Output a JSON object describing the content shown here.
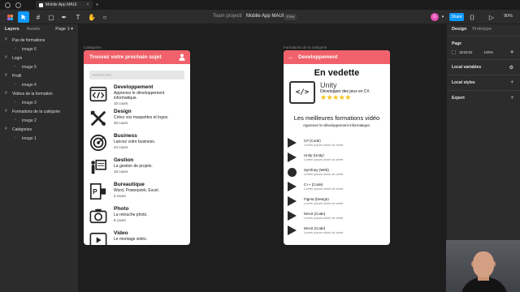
{
  "os": {
    "tab_title": "Mobile App MAUI"
  },
  "toolbar": {
    "breadcrumb_project": "Team project",
    "breadcrumb_sep": "/",
    "breadcrumb_file": "Mobile App MAUI",
    "plan_badge": "Free",
    "avatar_initial": "G",
    "share_label": "Share",
    "zoom": "90%"
  },
  "left_panel": {
    "tabs": [
      "Layers",
      "Assets"
    ],
    "page": "Page 1",
    "layers": [
      {
        "label": "Pas de formations",
        "level": "top"
      },
      {
        "label": "image 6",
        "level": "child"
      },
      {
        "label": "Login",
        "level": "top"
      },
      {
        "label": "image 5",
        "level": "child"
      },
      {
        "label": "Profil",
        "level": "top"
      },
      {
        "label": "image 4",
        "level": "child"
      },
      {
        "label": "Vidéos de la formation",
        "level": "top"
      },
      {
        "label": "image 3",
        "level": "child"
      },
      {
        "label": "Formations de la catégorie",
        "level": "top"
      },
      {
        "label": "image 2",
        "level": "child"
      },
      {
        "label": "Catégories",
        "level": "top"
      },
      {
        "label": "image 1",
        "level": "child"
      }
    ]
  },
  "canvas": {
    "frame1_label": "Catégories",
    "frame2_label": "Formations de la catégorie",
    "phone1": {
      "header": "Trouvez votre prochain sujet",
      "search_placeholder": "Rechercher",
      "categories": [
        {
          "title": "Developpement",
          "desc": "Apprenez le développement informatique.",
          "count": "10 cours",
          "icon": "code-icon"
        },
        {
          "title": "Design",
          "desc": "Créez vos maquettes et logos.",
          "count": "20 cours",
          "icon": "design-tools-icon"
        },
        {
          "title": "Business",
          "desc": "Lancez votre business.",
          "count": "24 cours",
          "icon": "target-icon"
        },
        {
          "title": "Gestion",
          "desc": "La gestion de projets.",
          "count": "16 cours",
          "icon": "presentation-icon"
        },
        {
          "title": "Bureautique",
          "desc": "Word, Powerpoint, Excel.",
          "count": "2 cours",
          "icon": "office-icon"
        },
        {
          "title": "Photo",
          "desc": "La retouche photo.",
          "count": "8 cours",
          "icon": "camera-icon"
        },
        {
          "title": "Video",
          "desc": "Le montage vidéo.",
          "count": "",
          "icon": "video-icon"
        }
      ]
    },
    "phone2": {
      "header": "Developpement",
      "featured_title": "En vedette",
      "featured_name": "Unity",
      "featured_desc": "Développer des jeux en C#.",
      "featured_stars": "★★★★★",
      "best_title": "Les meilleures formations vidéo",
      "best_sub": "Apprenez le développement informatique.",
      "videos": [
        {
          "title": "C# (Code)",
          "sub": "Lorem ipsum dolor sit amet",
          "icon": "play-icon"
        },
        {
          "title": "Unity (Unity)",
          "sub": "Lorem ipsum dolor sit amet",
          "icon": "play-icon"
        },
        {
          "title": "Symfony (Web)",
          "sub": "Lorem ipsum dolor sit amet",
          "icon": "symfony-icon"
        },
        {
          "title": "C++ (Code)",
          "sub": "Lorem ipsum dolor sit amet",
          "icon": "play-icon"
        },
        {
          "title": "Figma (Design)",
          "sub": "Lorem ipsum dolor sit amet",
          "icon": "play-icon"
        },
        {
          "title": "MAUI (Code)",
          "sub": "Lorem ipsum dolor sit amet",
          "icon": "play-icon"
        },
        {
          "title": "MAUI (Code)",
          "sub": "Lorem ipsum dolor sit amet",
          "icon": "play-icon"
        }
      ]
    }
  },
  "right_panel": {
    "tabs": [
      "Design",
      "Prototype"
    ],
    "page_section": "Page",
    "page_color": "1E1E1E",
    "page_opacity": "100%",
    "local_variables": "Local variables",
    "local_styles": "Local styles",
    "export": "Export"
  },
  "colors": {
    "accent": "#0d99ff",
    "header_red": "#f1616b",
    "canvas_bg": "#1e1e1e",
    "panel_bg": "#2c2c2c",
    "star": "#f5c518"
  }
}
